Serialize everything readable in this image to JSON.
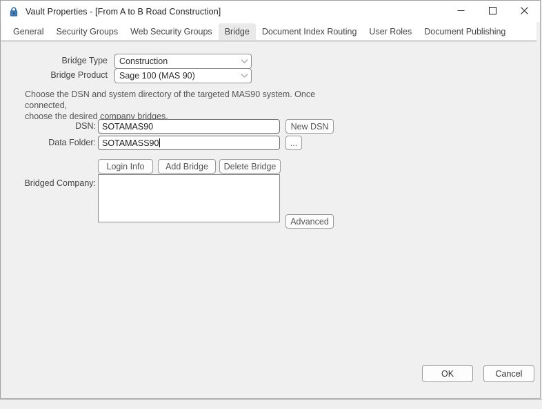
{
  "window": {
    "title": "Vault Properties - [From A to B Road Construction]",
    "icon": "lock-icon",
    "controls": {
      "minimize": "minimize-icon",
      "maximize": "maximize-icon",
      "close": "close-icon"
    }
  },
  "tabs": [
    {
      "label": "General",
      "active": false
    },
    {
      "label": "Security Groups",
      "active": false
    },
    {
      "label": "Web Security Groups",
      "active": false
    },
    {
      "label": "Bridge",
      "active": true
    },
    {
      "label": "Document Index Routing",
      "active": false
    },
    {
      "label": "User Roles",
      "active": false
    },
    {
      "label": "Document Publishing",
      "active": false
    }
  ],
  "form": {
    "bridge_type": {
      "label": "Bridge Type",
      "value": "Construction",
      "arrow": "chevron-down-icon"
    },
    "bridge_product": {
      "label": "Bridge Product",
      "value": "Sage 100 (MAS 90)",
      "arrow": "chevron-down-icon"
    },
    "help_text": "Choose the DSN and system directory of the targeted MAS90 system.  Once connected,\nchoose the desired company bridges.",
    "dsn": {
      "label": "DSN:",
      "value": "SOTAMAS90"
    },
    "new_dsn_button": "New DSN",
    "data_folder": {
      "label": "Data Folder:",
      "value": "SOTAMASS90",
      "focused": true
    },
    "browse_button": "...",
    "login_info_button": "Login Info",
    "add_bridge_button": "Add Bridge",
    "delete_bridge_button": "Delete Bridge",
    "bridged_company": {
      "label": "Bridged Company:",
      "items": []
    },
    "advanced_button": "Advanced"
  },
  "footer": {
    "ok_button": "OK",
    "cancel_button": "Cancel"
  },
  "colors": {
    "window_bg": "#f0f0f0",
    "titlebar_bg": "#ffffff",
    "tabstrip_bg": "#ffffff",
    "active_tab_bg": "#e9e9e9",
    "field_bg": "#ffffff",
    "border": "#8a8a8a",
    "text": "#444444",
    "lock_icon": "#2f6ea8"
  }
}
